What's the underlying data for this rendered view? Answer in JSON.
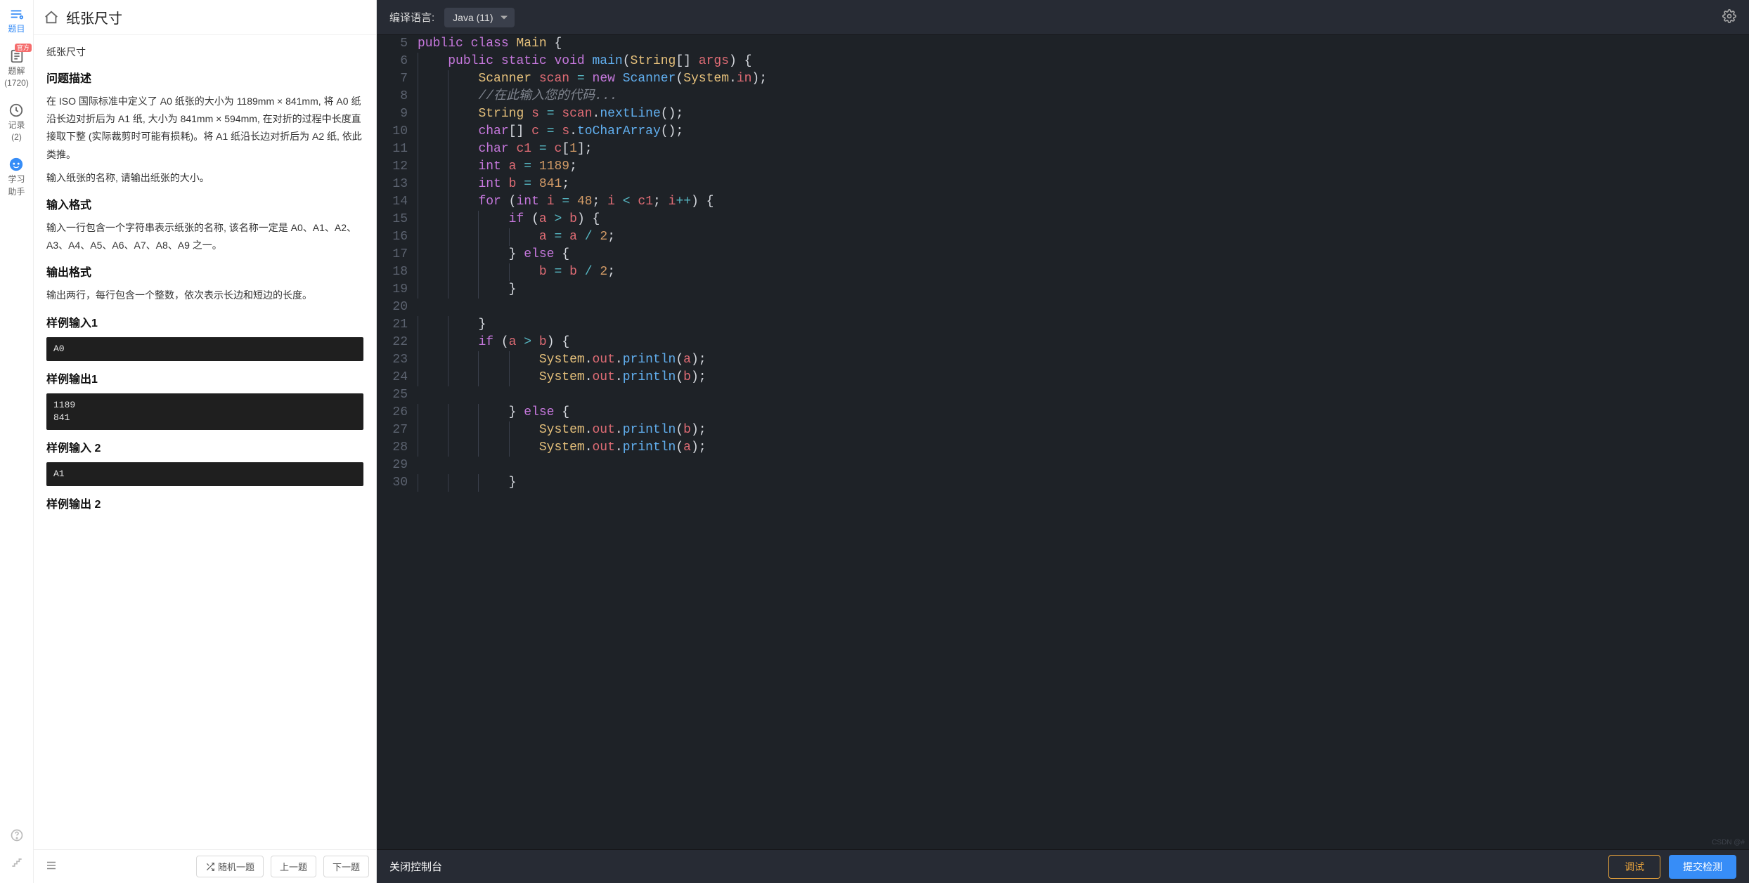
{
  "header": {
    "problem_title": "纸张尺寸"
  },
  "rail": {
    "items": [
      {
        "label": "题目",
        "icon": "problem-icon"
      },
      {
        "label": "题解",
        "count": "(1720)",
        "badge": "官方",
        "icon": "solution-icon"
      },
      {
        "label": "记录",
        "count": "(2)",
        "icon": "history-icon"
      },
      {
        "label": "学习",
        "label2": "助手",
        "icon": "assistant-icon"
      }
    ]
  },
  "problem": {
    "sub_title": "纸张尺寸",
    "h_desc": "问题描述",
    "desc_p1": "在 ISO 国际标准中定义了 A0 纸张的大小为 1189mm × 841mm, 将 A0 纸沿长边对折后为 A1 纸, 大小为 841mm × 594mm, 在对折的过程中长度直接取下整 (实际裁剪时可能有损耗)。将 A1 纸沿长边对折后为 A2 纸, 依此类推。",
    "desc_p2": "输入纸张的名称, 请输出纸张的大小。",
    "h_in": "输入格式",
    "in_p": "输入一行包含一个字符串表示纸张的名称, 该名称一定是 A0、A1、A2、A3、A4、A5、A6、A7、A8、A9 之一。",
    "h_out": "输出格式",
    "out_p": "输出两行，每行包含一个整数，依次表示长边和短边的长度。",
    "h_s_in1": "样例输入1",
    "s_in1": "A0",
    "h_s_out1": "样例输出1",
    "s_out1": "1189\n841",
    "h_s_in2": "样例输入 2",
    "s_in2": "A1",
    "h_s_out2": "样例输出 2"
  },
  "footer_left": {
    "random": "随机一题",
    "prev": "上一题",
    "next": "下一题"
  },
  "editor": {
    "lang_label": "编译语言:",
    "lang_selected": "Java  (11)",
    "console_label": "关闭控制台",
    "debug_btn": "调试",
    "submit_btn": "提交检测",
    "watermark": "CSDN @#"
  },
  "code": {
    "first_line_no": 5,
    "lines": [
      [
        [
          "kw",
          "public"
        ],
        [
          "pn",
          " "
        ],
        [
          "kw",
          "class"
        ],
        [
          "pn",
          " "
        ],
        [
          "cls",
          "Main"
        ],
        [
          "pn",
          " {"
        ]
      ],
      [
        [
          "pn",
          "    "
        ],
        [
          "kw",
          "public"
        ],
        [
          "pn",
          " "
        ],
        [
          "kw",
          "static"
        ],
        [
          "pn",
          " "
        ],
        [
          "type",
          "void"
        ],
        [
          "pn",
          " "
        ],
        [
          "fn",
          "main"
        ],
        [
          "pn",
          "("
        ],
        [
          "cls",
          "String"
        ],
        [
          "pn",
          "[] "
        ],
        [
          "var",
          "args"
        ],
        [
          "pn",
          ") {"
        ]
      ],
      [
        [
          "pn",
          "        "
        ],
        [
          "cls",
          "Scanner"
        ],
        [
          "pn",
          " "
        ],
        [
          "var",
          "scan"
        ],
        [
          "pn",
          " "
        ],
        [
          "op",
          "="
        ],
        [
          "pn",
          " "
        ],
        [
          "kw",
          "new"
        ],
        [
          "pn",
          " "
        ],
        [
          "fn",
          "Scanner"
        ],
        [
          "pn",
          "("
        ],
        [
          "cls",
          "System"
        ],
        [
          "pn",
          "."
        ],
        [
          "var",
          "in"
        ],
        [
          "pn",
          ");"
        ]
      ],
      [
        [
          "pn",
          "        "
        ],
        [
          "cmt",
          "//在此输入您的代码..."
        ]
      ],
      [
        [
          "pn",
          "        "
        ],
        [
          "cls",
          "String"
        ],
        [
          "pn",
          " "
        ],
        [
          "var",
          "s"
        ],
        [
          "pn",
          " "
        ],
        [
          "op",
          "="
        ],
        [
          "pn",
          " "
        ],
        [
          "var",
          "scan"
        ],
        [
          "pn",
          "."
        ],
        [
          "fn",
          "nextLine"
        ],
        [
          "pn",
          "();"
        ]
      ],
      [
        [
          "pn",
          "        "
        ],
        [
          "type",
          "char"
        ],
        [
          "pn",
          "[] "
        ],
        [
          "var",
          "c"
        ],
        [
          "pn",
          " "
        ],
        [
          "op",
          "="
        ],
        [
          "pn",
          " "
        ],
        [
          "var",
          "s"
        ],
        [
          "pn",
          "."
        ],
        [
          "fn",
          "toCharArray"
        ],
        [
          "pn",
          "();"
        ]
      ],
      [
        [
          "pn",
          "        "
        ],
        [
          "type",
          "char"
        ],
        [
          "pn",
          " "
        ],
        [
          "var",
          "c1"
        ],
        [
          "pn",
          " "
        ],
        [
          "op",
          "="
        ],
        [
          "pn",
          " "
        ],
        [
          "var",
          "c"
        ],
        [
          "pn",
          "["
        ],
        [
          "num",
          "1"
        ],
        [
          "pn",
          "];"
        ]
      ],
      [
        [
          "pn",
          "        "
        ],
        [
          "type",
          "int"
        ],
        [
          "pn",
          " "
        ],
        [
          "var",
          "a"
        ],
        [
          "pn",
          " "
        ],
        [
          "op",
          "="
        ],
        [
          "pn",
          " "
        ],
        [
          "num",
          "1189"
        ],
        [
          "pn",
          ";"
        ]
      ],
      [
        [
          "pn",
          "        "
        ],
        [
          "type",
          "int"
        ],
        [
          "pn",
          " "
        ],
        [
          "var",
          "b"
        ],
        [
          "pn",
          " "
        ],
        [
          "op",
          "="
        ],
        [
          "pn",
          " "
        ],
        [
          "num",
          "841"
        ],
        [
          "pn",
          ";"
        ]
      ],
      [
        [
          "pn",
          "        "
        ],
        [
          "kw",
          "for"
        ],
        [
          "pn",
          " ("
        ],
        [
          "type",
          "int"
        ],
        [
          "pn",
          " "
        ],
        [
          "var",
          "i"
        ],
        [
          "pn",
          " "
        ],
        [
          "op",
          "="
        ],
        [
          "pn",
          " "
        ],
        [
          "num",
          "48"
        ],
        [
          "pn",
          "; "
        ],
        [
          "var",
          "i"
        ],
        [
          "pn",
          " "
        ],
        [
          "op",
          "<"
        ],
        [
          "pn",
          " "
        ],
        [
          "var",
          "c1"
        ],
        [
          "pn",
          "; "
        ],
        [
          "var",
          "i"
        ],
        [
          "op",
          "++"
        ],
        [
          "pn",
          ") {"
        ]
      ],
      [
        [
          "pn",
          "            "
        ],
        [
          "kw",
          "if"
        ],
        [
          "pn",
          " ("
        ],
        [
          "var",
          "a"
        ],
        [
          "pn",
          " "
        ],
        [
          "op",
          ">"
        ],
        [
          "pn",
          " "
        ],
        [
          "var",
          "b"
        ],
        [
          "pn",
          ") {"
        ]
      ],
      [
        [
          "pn",
          "                "
        ],
        [
          "var",
          "a"
        ],
        [
          "pn",
          " "
        ],
        [
          "op",
          "="
        ],
        [
          "pn",
          " "
        ],
        [
          "var",
          "a"
        ],
        [
          "pn",
          " "
        ],
        [
          "op",
          "/"
        ],
        [
          "pn",
          " "
        ],
        [
          "num",
          "2"
        ],
        [
          "pn",
          ";"
        ]
      ],
      [
        [
          "pn",
          "            } "
        ],
        [
          "kw",
          "else"
        ],
        [
          "pn",
          " {"
        ]
      ],
      [
        [
          "pn",
          "                "
        ],
        [
          "var",
          "b"
        ],
        [
          "pn",
          " "
        ],
        [
          "op",
          "="
        ],
        [
          "pn",
          " "
        ],
        [
          "var",
          "b"
        ],
        [
          "pn",
          " "
        ],
        [
          "op",
          "/"
        ],
        [
          "pn",
          " "
        ],
        [
          "num",
          "2"
        ],
        [
          "pn",
          ";"
        ]
      ],
      [
        [
          "pn",
          "            }"
        ]
      ],
      [
        [
          "pn",
          ""
        ]
      ],
      [
        [
          "pn",
          "        }"
        ]
      ],
      [
        [
          "pn",
          "        "
        ],
        [
          "kw",
          "if"
        ],
        [
          "pn",
          " ("
        ],
        [
          "var",
          "a"
        ],
        [
          "pn",
          " "
        ],
        [
          "op",
          ">"
        ],
        [
          "pn",
          " "
        ],
        [
          "var",
          "b"
        ],
        [
          "pn",
          ") {"
        ]
      ],
      [
        [
          "pn",
          "                "
        ],
        [
          "cls",
          "System"
        ],
        [
          "pn",
          "."
        ],
        [
          "var",
          "out"
        ],
        [
          "pn",
          "."
        ],
        [
          "fn",
          "println"
        ],
        [
          "pn",
          "("
        ],
        [
          "var",
          "a"
        ],
        [
          "pn",
          ");"
        ]
      ],
      [
        [
          "pn",
          "                "
        ],
        [
          "cls",
          "System"
        ],
        [
          "pn",
          "."
        ],
        [
          "var",
          "out"
        ],
        [
          "pn",
          "."
        ],
        [
          "fn",
          "println"
        ],
        [
          "pn",
          "("
        ],
        [
          "var",
          "b"
        ],
        [
          "pn",
          ");"
        ]
      ],
      [
        [
          "pn",
          ""
        ]
      ],
      [
        [
          "pn",
          "            } "
        ],
        [
          "kw",
          "else"
        ],
        [
          "pn",
          " {"
        ]
      ],
      [
        [
          "pn",
          "                "
        ],
        [
          "cls",
          "System"
        ],
        [
          "pn",
          "."
        ],
        [
          "var",
          "out"
        ],
        [
          "pn",
          "."
        ],
        [
          "fn",
          "println"
        ],
        [
          "pn",
          "("
        ],
        [
          "var",
          "b"
        ],
        [
          "pn",
          ");"
        ]
      ],
      [
        [
          "pn",
          "                "
        ],
        [
          "cls",
          "System"
        ],
        [
          "pn",
          "."
        ],
        [
          "var",
          "out"
        ],
        [
          "pn",
          "."
        ],
        [
          "fn",
          "println"
        ],
        [
          "pn",
          "("
        ],
        [
          "var",
          "a"
        ],
        [
          "pn",
          ");"
        ]
      ],
      [
        [
          "pn",
          ""
        ]
      ],
      [
        [
          "pn",
          "            }"
        ]
      ]
    ]
  }
}
